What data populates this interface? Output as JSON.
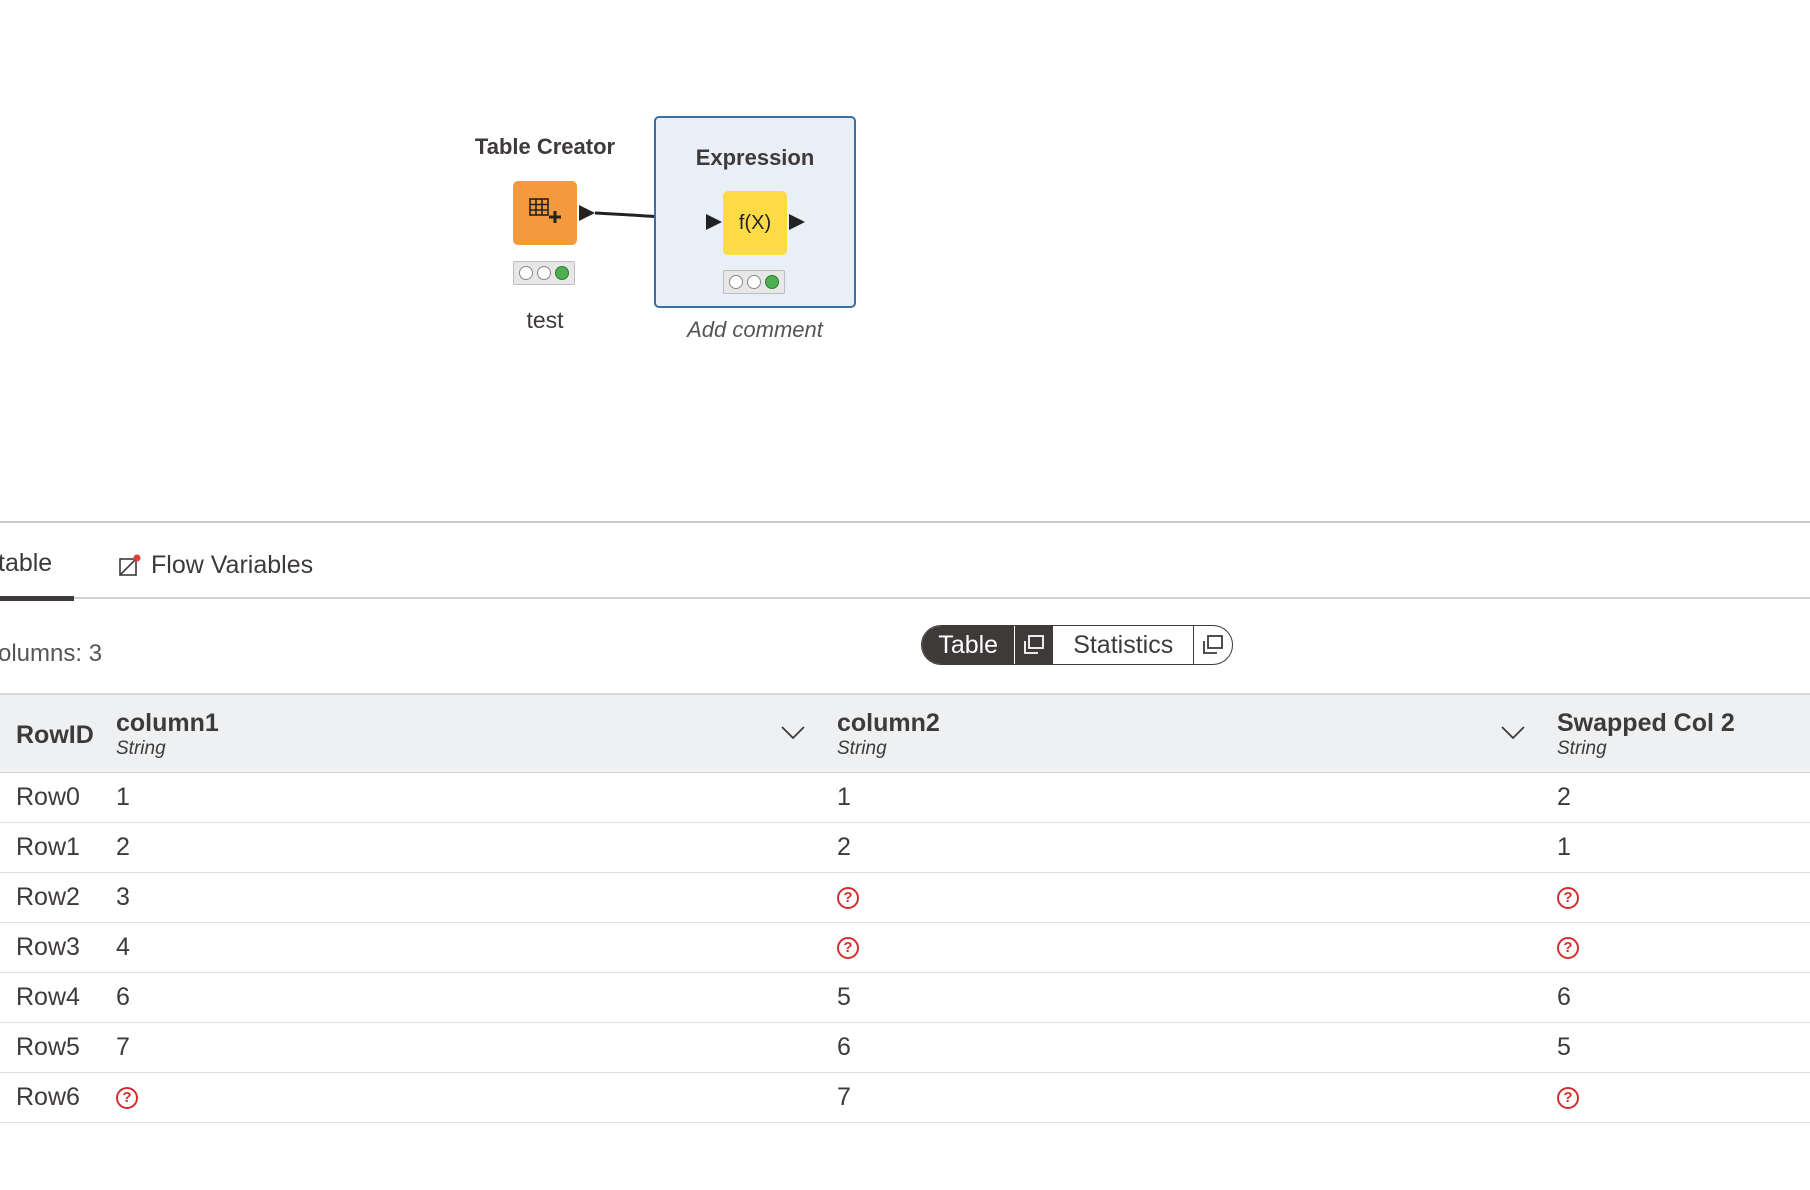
{
  "workflow": {
    "nodes": [
      {
        "title": "Table Creator",
        "label": "test",
        "color": "#f39a3e"
      },
      {
        "title": "Expression",
        "comment": "Add comment",
        "color": "#fddb45"
      }
    ],
    "expression_icon_text": "f(X)"
  },
  "panel": {
    "tabs": [
      {
        "label": "table"
      },
      {
        "label": "Flow Variables"
      }
    ],
    "columns_count": "olumns: 3",
    "view_toggle": {
      "table": "Table",
      "statistics": "Statistics",
      "active": "Table"
    }
  },
  "table": {
    "rowid_header": "RowID",
    "columns": [
      {
        "name": "column1",
        "type": "String"
      },
      {
        "name": "column2",
        "type": "String"
      },
      {
        "name": "Swapped Col 2",
        "type": "String"
      }
    ],
    "missing_symbol": "?",
    "rows": [
      {
        "id": "Row0",
        "values": [
          "1",
          "1",
          "2"
        ]
      },
      {
        "id": "Row1",
        "values": [
          "2",
          "2",
          "1"
        ]
      },
      {
        "id": "Row2",
        "values": [
          "3",
          null,
          null
        ]
      },
      {
        "id": "Row3",
        "values": [
          "4",
          null,
          null
        ]
      },
      {
        "id": "Row4",
        "values": [
          "6",
          "5",
          "6"
        ]
      },
      {
        "id": "Row5",
        "values": [
          "7",
          "6",
          "5"
        ]
      },
      {
        "id": "Row6",
        "values": [
          null,
          "7",
          null
        ]
      }
    ]
  },
  "colors": {
    "accent_dark": "#3e3a39",
    "selection_border": "#3a6ea5",
    "missing_red": "#d32f2f",
    "status_green": "#4caf50"
  }
}
